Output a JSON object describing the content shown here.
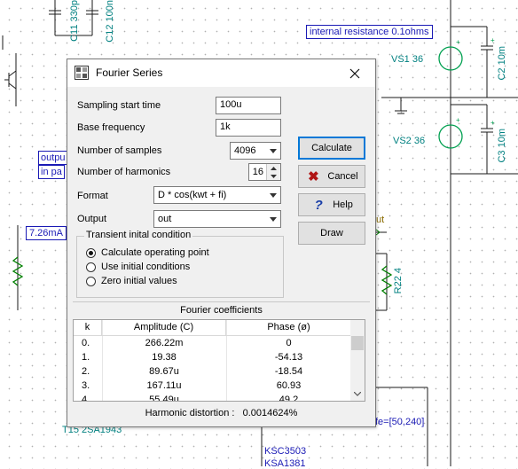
{
  "schematic": {
    "labels": {
      "c11": "C11 330p",
      "c12": "C12 100n",
      "internal_resistance": "internal resistance 0.1ohms",
      "vs1": "VS1 36",
      "c2": "C2 10m",
      "vs2": "VS2 36",
      "c3": "C3 10m",
      "output_a": "outpu",
      "output_b": "in pa",
      "current": "7.26mA",
      "r22": "R22 4",
      "t15": "T15 2SA1943",
      "ksc3503": "KSC3503",
      "ksa1381": "KSA1381",
      "hfe": "fe=[50,240]",
      "ut": "ut"
    }
  },
  "dialog": {
    "title": "Fourier Series",
    "icon": "fourier-app-icon",
    "close_icon": "close-icon",
    "fields": {
      "sampling_start_time": {
        "label": "Sampling start time",
        "value": "100u"
      },
      "base_frequency": {
        "label": "Base frequency",
        "value": "1k"
      },
      "number_of_samples": {
        "label": "Number of samples",
        "value": "4096"
      },
      "number_of_harmonics": {
        "label": "Number of harmonics",
        "value": "16"
      },
      "format": {
        "label": "Format",
        "value": "D * cos(kwt + fi)"
      },
      "output": {
        "label": "Output",
        "value": "out"
      }
    },
    "buttons": {
      "calculate": "Calculate",
      "cancel": "Cancel",
      "help": "Help",
      "draw": "Draw"
    },
    "transient": {
      "title": "Transient inital condition",
      "options": [
        "Calculate operating point",
        "Use initial conditions",
        "Zero initial values"
      ],
      "selected": 0
    },
    "coefficients": {
      "title": "Fourier coefficients",
      "columns": [
        "k",
        "Amplitude (C)",
        "Phase (ø)"
      ],
      "rows": [
        [
          "0.",
          "266.22m",
          "0"
        ],
        [
          "1.",
          "19.38",
          "-54.13"
        ],
        [
          "2.",
          "89.67u",
          "-18.54"
        ],
        [
          "3.",
          "167.11u",
          "60.93"
        ],
        [
          "4.",
          "55.49u",
          "49.2"
        ]
      ]
    },
    "distortion": {
      "label": "Harmonic distortion :",
      "value": "0.0014624%"
    }
  },
  "colors": {
    "schematic_wire": "#1a1a1a",
    "schematic_label": "#008080",
    "schematic_box": "#1a1ab5",
    "source": "#00a050",
    "resistor": "#008000",
    "default_button_border": "#0078d7"
  }
}
